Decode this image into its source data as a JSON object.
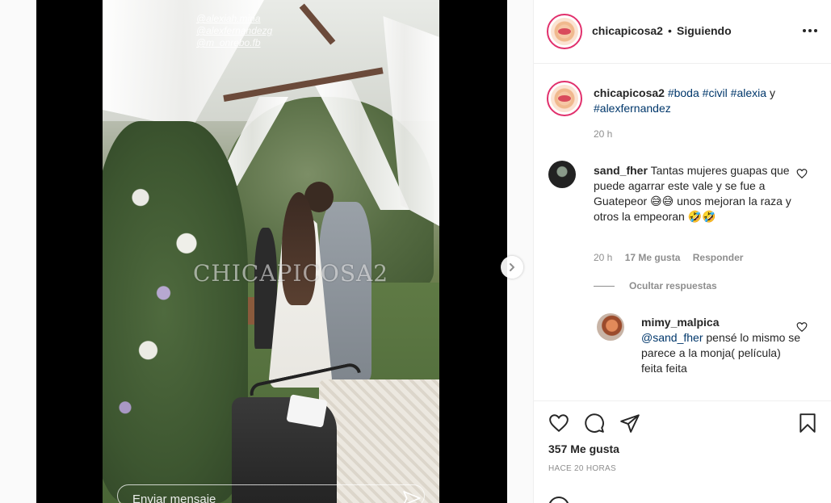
{
  "media": {
    "story_tags": [
      "@alexiah.mina",
      "@alexfernandezg",
      "@m_onrebo.fb"
    ],
    "watermark": "CHICAPICOSA2",
    "reply_placeholder": "Enviar mensaje"
  },
  "header": {
    "username": "chicapicosa2",
    "separator": "•",
    "follow_status": "Siguiendo"
  },
  "caption": {
    "username": "chicapicosa2",
    "tags": [
      "#boda",
      "#civil",
      "#alexia"
    ],
    "conjunction": "y",
    "tag_last": "#alexfernandez",
    "time": "20 h"
  },
  "comment": {
    "username": "sand_fher",
    "text": "Tantas mujeres guapas que puede agarrar este vale y se fue a Guatepeor 😅😅 unos mejoran la raza y otros la empeoran 🤣🤣",
    "time": "20 h",
    "likes": "17 Me gusta",
    "reply_label": "Responder"
  },
  "hide_replies": "Ocultar respuestas",
  "reply": {
    "username": "mimy_malpica",
    "mention": "@sand_fher",
    "text": "pensé lo mismo se parece a la monja( película) feita feita"
  },
  "actions": {
    "likes": "357 Me gusta",
    "posted_ago": "HACE 20 HORAS"
  },
  "icons": [
    "chevron-right-icon",
    "more-icon",
    "heart-icon",
    "comment-icon",
    "share-icon",
    "save-icon",
    "send-icon",
    "emoji-icon"
  ]
}
